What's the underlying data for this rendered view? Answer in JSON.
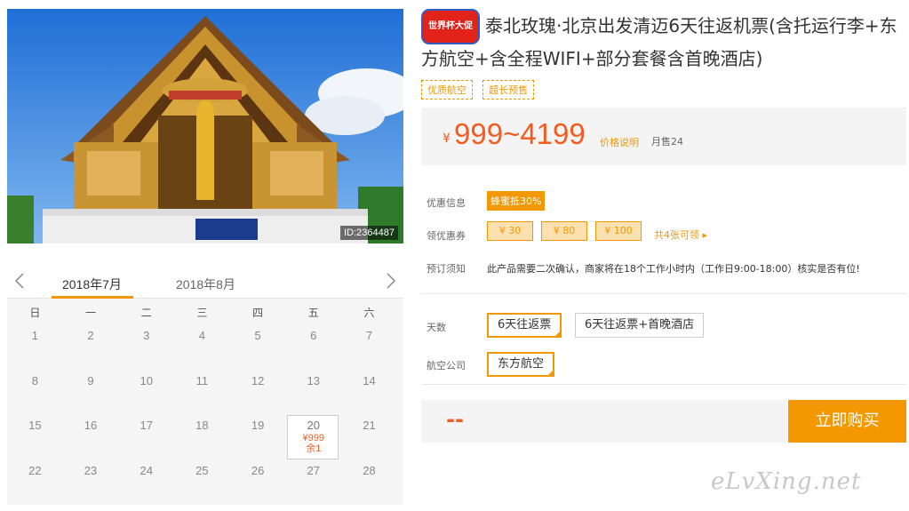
{
  "hero": {
    "image_id": "ID:2364487"
  },
  "calendar": {
    "months": [
      "2018年7月",
      "2018年8月"
    ],
    "weekdays": [
      "日",
      "一",
      "二",
      "三",
      "四",
      "五",
      "六"
    ],
    "days": [
      {
        "d": "1"
      },
      {
        "d": "2"
      },
      {
        "d": "3"
      },
      {
        "d": "4"
      },
      {
        "d": "5"
      },
      {
        "d": "6"
      },
      {
        "d": "7"
      },
      {
        "d": "8"
      },
      {
        "d": "9"
      },
      {
        "d": "10"
      },
      {
        "d": "11"
      },
      {
        "d": "12"
      },
      {
        "d": "13"
      },
      {
        "d": "14"
      },
      {
        "d": "15"
      },
      {
        "d": "16"
      },
      {
        "d": "17"
      },
      {
        "d": "18"
      },
      {
        "d": "19"
      },
      {
        "d": "20",
        "price": "¥999",
        "left": "余1"
      },
      {
        "d": "21"
      },
      {
        "d": "22"
      },
      {
        "d": "23"
      },
      {
        "d": "24"
      },
      {
        "d": "25"
      },
      {
        "d": "26"
      },
      {
        "d": "27"
      },
      {
        "d": "28"
      }
    ]
  },
  "product": {
    "badge": "世界杯大促",
    "title": "泰北玫瑰·北京出发清迈6天往返机票(含托运行李+东方航空+含全程WIFI+部分套餐含首晚酒店)",
    "tags": [
      "优质航空",
      "超长预售"
    ]
  },
  "price": {
    "currency": "¥",
    "range": "999~4199",
    "explain": "价格说明",
    "sold": "月售24"
  },
  "promo": {
    "label": "优惠信息",
    "discount": "蜂蜜抵30%"
  },
  "coupons": {
    "label": "领优惠券",
    "items": [
      "¥ 30",
      "¥ 80",
      "¥ 100"
    ],
    "more": "共4张可领 ▸"
  },
  "notice": {
    "label": "预订须知",
    "text": "此产品需要二次确认，商家将在18个工作小时内（工作日9:00-18:00）核实是否有位!"
  },
  "options": {
    "days_label": "天数",
    "days_opts": [
      "6天往返票",
      "6天往返票+首晚酒店"
    ],
    "airline_label": "航空公司",
    "airline_opts": [
      "东方航空"
    ]
  },
  "buy": {
    "price": "--",
    "button": "立即购买"
  },
  "watermark": "eLvXing.net",
  "colors": {
    "accent": "#f39800",
    "price": "#f35c20",
    "badge_red": "#e2231a"
  }
}
